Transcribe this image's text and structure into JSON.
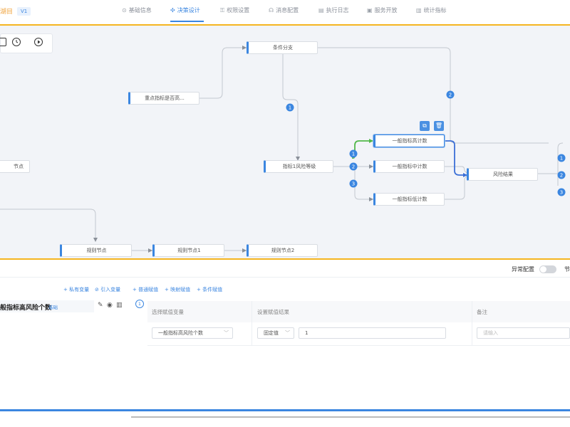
{
  "header": {
    "app_name": "湖目",
    "version": "V1",
    "tabs": [
      {
        "label": "基础信息",
        "icon": "info-icon",
        "glyph": "⊙"
      },
      {
        "label": "决策设计",
        "icon": "design-icon",
        "glyph": "✣",
        "active": true
      },
      {
        "label": "权限设置",
        "icon": "lock-icon",
        "glyph": "⚿"
      },
      {
        "label": "消息配置",
        "icon": "headset-icon",
        "glyph": "☊"
      },
      {
        "label": "执行日志",
        "icon": "log-icon",
        "glyph": "▤"
      },
      {
        "label": "服务开放",
        "icon": "service-icon",
        "glyph": "▣"
      },
      {
        "label": "统计指标",
        "icon": "stats-icon",
        "glyph": "▥"
      }
    ]
  },
  "canvas": {
    "toolbar": [
      "fit-view-icon",
      "clock-icon",
      "play-icon"
    ],
    "nodes": {
      "condition_branch": "条件分支",
      "key_indicator": "重点指标是否高...",
      "left_node": "节点",
      "indicator_risk_level": "指标1风险等级",
      "general_high": "一般指标高计数",
      "general_mid": "一般指标中计数",
      "general_low": "一般指标低计数",
      "risk_result": "风险结果",
      "rule_node": "规则节点",
      "rule_node_1": "规则节点1",
      "rule_node_2": "规则节点2"
    },
    "badges": {
      "b1": "1",
      "b2": "2",
      "b3": "3"
    },
    "node_actions": [
      "copy-icon",
      "delete-icon"
    ],
    "colors": {
      "accent": "#3b86e0",
      "highlight_edge": "#52b84a",
      "border_yellow": "#f5b520"
    }
  },
  "panel": {
    "exception_config": "异常配置",
    "truncated_label": "节",
    "add_buttons": [
      "+ 私有变量",
      "⊘ 引入变量",
      "+ 普通赋值",
      "+ 映射赋值",
      "+ 条件赋值"
    ],
    "variable": {
      "name": "般指标高风险个数",
      "badge": "基础"
    },
    "step": "1",
    "table": {
      "headers": [
        "选择赋值变量",
        "设置赋值结果",
        "备注"
      ],
      "row": {
        "variable": "一般指标高风险个数",
        "value_type": "固定值",
        "value": "1",
        "remark_placeholder": "请输入"
      }
    }
  }
}
